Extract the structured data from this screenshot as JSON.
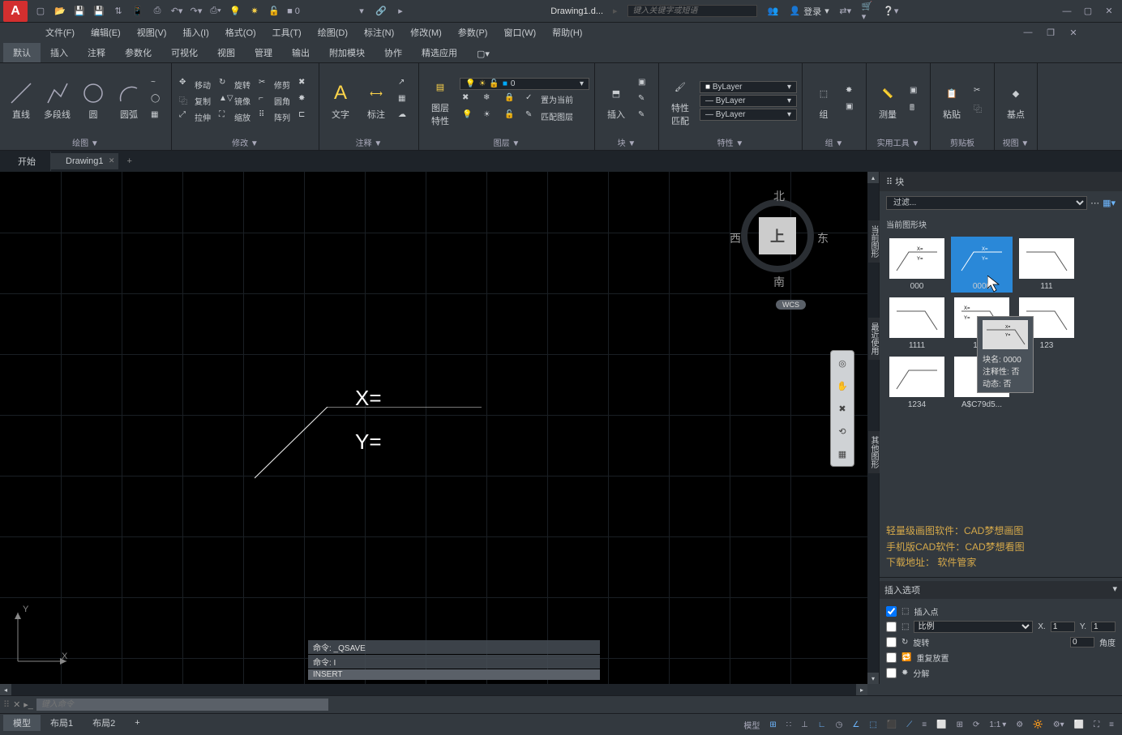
{
  "title": {
    "doc": "Drawing1.d...",
    "login": "登录"
  },
  "search": {
    "placeholder": "键入关键字或短语"
  },
  "menus": [
    "文件(F)",
    "编辑(E)",
    "视图(V)",
    "插入(I)",
    "格式(O)",
    "工具(T)",
    "绘图(D)",
    "标注(N)",
    "修改(M)",
    "参数(P)",
    "窗口(W)",
    "帮助(H)"
  ],
  "ribbonTabs": [
    "默认",
    "插入",
    "注释",
    "参数化",
    "可视化",
    "视图",
    "管理",
    "输出",
    "附加模块",
    "协作",
    "精选应用"
  ],
  "ribbon": {
    "draw": {
      "title": "绘图 ▼",
      "line": "直线",
      "polyline": "多段线",
      "circle": "圆",
      "arc": "圆弧"
    },
    "modify": {
      "title": "修改 ▼",
      "move": "移动",
      "rotate": "旋转",
      "trim": "修剪",
      "copy": "复制",
      "mirror": "镜像",
      "fillet": "圆角",
      "stretch": "拉伸",
      "scale": "缩放",
      "array": "阵列"
    },
    "annot": {
      "title": "注释 ▼",
      "text": "文字",
      "dim": "标注"
    },
    "layers": {
      "title": "图层 ▼",
      "props": "图层\n特性",
      "current_layer": "0",
      "setcur": "置为当前",
      "match": "匹配图层"
    },
    "block": {
      "title": "块 ▼",
      "insert": "插入"
    },
    "props": {
      "title": "特性 ▼",
      "match": "特性\n匹配",
      "bylayer1": "ByLayer",
      "bylayer2": "ByLayer",
      "bylayer3": "ByLayer"
    },
    "groups": {
      "title": "组 ▼",
      "group": "组"
    },
    "util": {
      "title": "实用工具 ▼",
      "measure": "测量"
    },
    "clip": {
      "title": "剪贴板",
      "paste": "粘贴"
    },
    "view": {
      "title": "视图 ▼",
      "base": "基点"
    }
  },
  "docTabs": {
    "start": "开始",
    "drawing": "Drawing1"
  },
  "canvas": {
    "viewcube": {
      "top": "上",
      "n": "北",
      "s": "南",
      "e": "东",
      "w": "西",
      "wcs": "WCS"
    },
    "x": "X",
    "y": "Y",
    "leader": {
      "x": "X=",
      "y": "Y="
    },
    "cmd1": "命令: _QSAVE",
    "cmd2": "命令: I",
    "cmd3": "INSERT"
  },
  "cmdInput": {
    "placeholder": "键入命令"
  },
  "rightPanel": {
    "title": "块",
    "filter": "过滤...",
    "currentBlocks": "当前图形块",
    "sideTabs": {
      "current": "当前图形",
      "recent": "最近使用",
      "other": "其他图形"
    },
    "blocks": [
      {
        "name": "000",
        "label": "X=\nY="
      },
      {
        "name": "0000",
        "label": "X=\nY="
      },
      {
        "name": "111",
        "label": ""
      },
      {
        "name": "1111",
        "label": ""
      },
      {
        "name": "1122",
        "label": "X=\nY="
      },
      {
        "name": "123",
        "label": ""
      },
      {
        "name": "1234",
        "label": ""
      },
      {
        "name": "A$C79d5...",
        "label": ""
      }
    ],
    "tooltip": {
      "name": "块名: 0000",
      "ann": "注释性: 否",
      "dyn": "动态: 否"
    },
    "promo1": "轻量级画图软件：CAD梦想画图",
    "promo2": "手机版CAD软件：CAD梦想看图",
    "promo3": "下载地址： 软件管家",
    "insertOpts": {
      "title": "插入选项",
      "insertPt": "插入点",
      "scale": "比例",
      "scaleX": "X.",
      "scaleXV": "1",
      "scaleY": "Y.",
      "scaleYV": "1",
      "rotate": "旋转",
      "rotVal": "0",
      "angle": "角度",
      "repeat": "重复放置",
      "explode": "分解"
    }
  },
  "layoutTabs": {
    "model": "模型",
    "l1": "布局1",
    "l2": "布局2"
  },
  "status": {
    "model": "模型",
    "scale": "1:1"
  }
}
